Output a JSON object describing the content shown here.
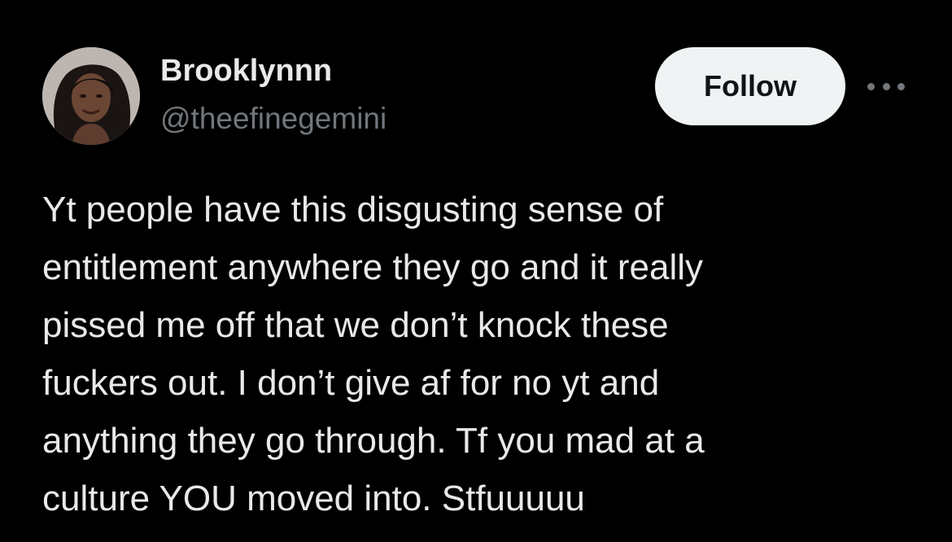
{
  "colors": {
    "background": "#000000",
    "primary_text": "#e7e9ea",
    "secondary_text": "#71767b",
    "follow_bg": "#eff3f4",
    "follow_text": "#0f1419"
  },
  "author": {
    "display_name": "Brooklynnn",
    "handle": "@theefinegemini",
    "avatar_icon": "user-avatar"
  },
  "actions": {
    "follow_label": "Follow",
    "more_icon": "more-horizontal-icon"
  },
  "tweet": {
    "lines": [
      "Yt people have this disgusting sense of",
      "entitlement anywhere they go and it really",
      "pissed me off that we don’t knock these",
      "fuckers out. I don’t give af for no yt and",
      "anything they go through. Tf you mad at a",
      "culture YOU moved into. Stfuuuuu"
    ]
  }
}
